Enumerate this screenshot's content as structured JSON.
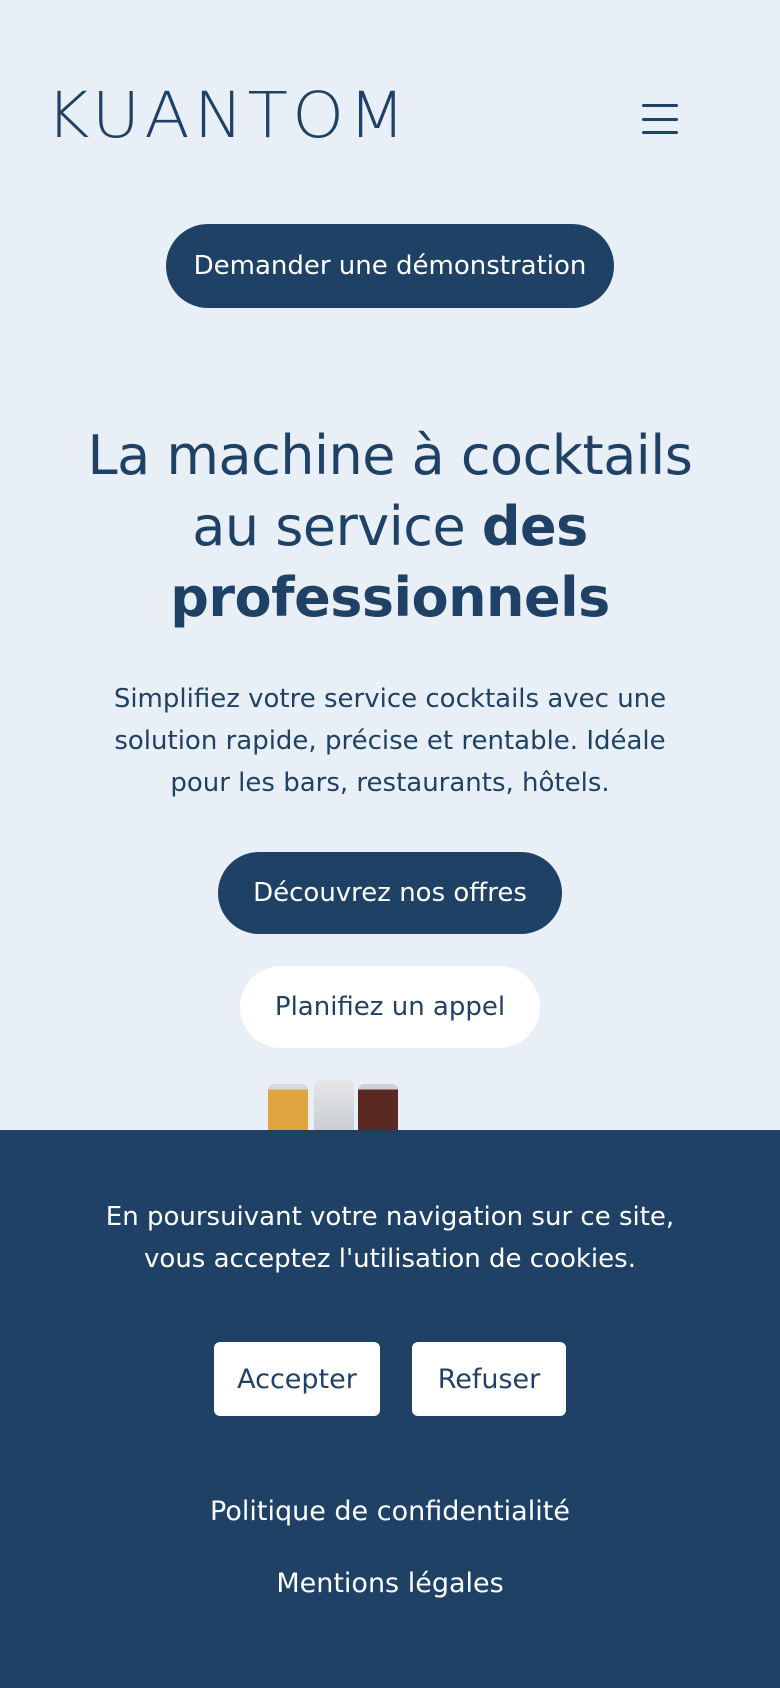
{
  "header": {
    "logo_text": "KUANTOM",
    "menu_icon": "hamburger-menu-icon"
  },
  "cta_demo_label": "Demander une démonstration",
  "hero": {
    "title_part1": "La machine à cocktails au service ",
    "title_bold": "des professionnels",
    "subtitle": "Simplifiez votre service cocktails avec une solution rapide, précise et rentable. Idéale pour les bars, restaurants, hôtels.",
    "primary_label": "Découvrez nos offres",
    "secondary_label": "Planifiez un appel"
  },
  "cookie_banner": {
    "message": "En poursuivant votre navigation sur ce site, vous acceptez l'utilisation de cookies.",
    "accept_label": "Accepter",
    "refuse_label": "Refuser",
    "privacy_link": "Politique de confidentialité",
    "legal_link": "Mentions légales"
  },
  "colors": {
    "background": "#e9eff6",
    "brand_navy": "#1f4166",
    "white": "#ffffff"
  }
}
